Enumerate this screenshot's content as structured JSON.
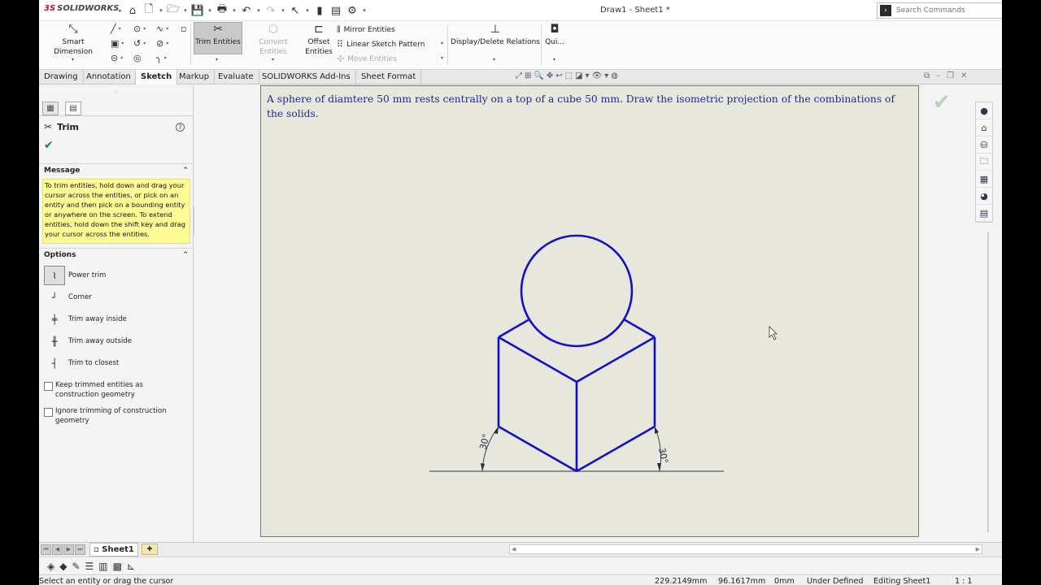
{
  "app": {
    "logo_ds": "3S",
    "logo_text": "SOLIDWORKS",
    "document_title": "Draw1 - Sheet1 *"
  },
  "search": {
    "placeholder": "Search Commands"
  },
  "ribbon": {
    "smart_dimension": "Smart Dimension",
    "trim_entities": "Trim Entities",
    "convert_entities": "Convert Entities",
    "offset_entities_line1": "Offset",
    "offset_entities_line2": "Entities",
    "mirror_entities": "Mirror Entities",
    "linear_sketch_pattern": "Linear Sketch Pattern",
    "move_entities": "Move Entities",
    "display_delete_relations": "Display/Delete Relations",
    "quick_snaps": "Qui..."
  },
  "tabs": [
    {
      "label": "Drawing"
    },
    {
      "label": "Annotation"
    },
    {
      "label": "Sketch"
    },
    {
      "label": "Markup"
    },
    {
      "label": "Evaluate"
    },
    {
      "label": "SOLIDWORKS Add-Ins"
    },
    {
      "label": "Sheet Format"
    }
  ],
  "property_manager": {
    "title": "Trim",
    "message_header": "Message",
    "message_text": "To trim entities, hold down and drag your cursor across the entities, or pick on an entity and then pick on a bounding entity or anywhere on the screen.  To extend entities, hold down the shift key and drag your cursor across the entities.",
    "options_header": "Options",
    "options": [
      {
        "label": "Power trim"
      },
      {
        "label": "Corner"
      },
      {
        "label": "Trim away inside"
      },
      {
        "label": "Trim away outside"
      },
      {
        "label": "Trim to closest"
      }
    ],
    "keep_trimmed": "Keep trimmed entities as construction geometry",
    "ignore_trimming": "Ignore trimming of construction geometry"
  },
  "sheet": {
    "problem_text": "A sphere of diamtere 50 mm rests centrally on a top of a cube 50 mm. Draw the isometric projection of the combinations of the solids.",
    "angle_left": "30°",
    "angle_right": "30°"
  },
  "sheet_tabs": {
    "sheet1": "Sheet1"
  },
  "status_bar": {
    "prompt": "Select an entity or drag the cursor",
    "x": "229.2149mm",
    "y": "96.1617mm",
    "z": "0mm",
    "definition": "Under Defined",
    "editing": "Editing Sheet1",
    "scale": "1 : 1"
  },
  "colors": {
    "sketch_blue": "#1010c8",
    "message_yellow": "#fdfc94",
    "text_blue": "#1a2a9a"
  }
}
